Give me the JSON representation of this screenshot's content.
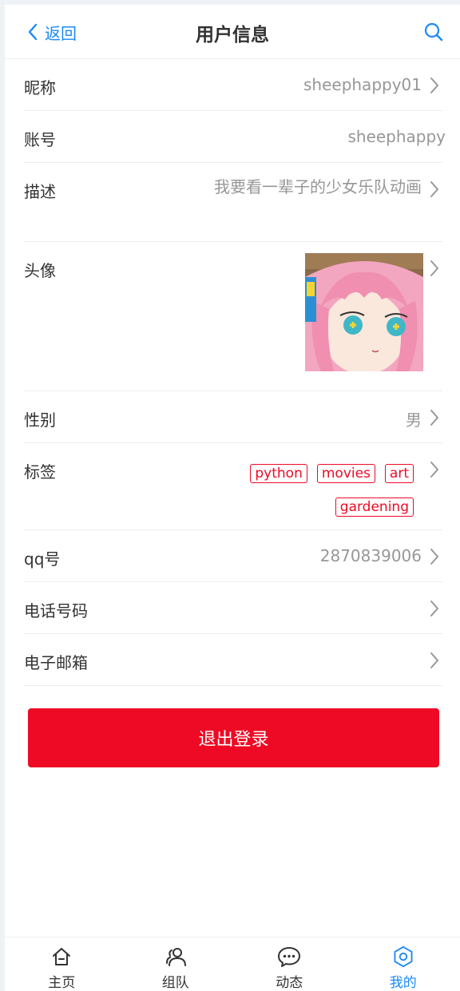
{
  "nav": {
    "back_label": "返回",
    "title": "用户信息"
  },
  "fields": {
    "nickname": {
      "label": "昵称",
      "value": "sheephappy01"
    },
    "account": {
      "label": "账号",
      "value": "sheephappy"
    },
    "description": {
      "label": "描述",
      "value": "我要看一辈子的少女乐队动画"
    },
    "avatar": {
      "label": "头像"
    },
    "gender": {
      "label": "性别",
      "value": "男"
    },
    "tags": {
      "label": "标签",
      "items": [
        "python",
        "movies",
        "art",
        "gardening"
      ]
    },
    "qq": {
      "label": "qq号",
      "value": "2870839006"
    },
    "phone": {
      "label": "电话号码",
      "value": ""
    },
    "email": {
      "label": "电子邮箱",
      "value": ""
    }
  },
  "logout_label": "退出登录",
  "tabbar": {
    "items": [
      {
        "label": "主页",
        "icon": "home-icon"
      },
      {
        "label": "组队",
        "icon": "team-icon"
      },
      {
        "label": "动态",
        "icon": "chat-icon"
      },
      {
        "label": "我的",
        "icon": "settings-icon"
      }
    ],
    "active_index": 3
  },
  "colors": {
    "accent": "#1989fa",
    "danger": "#ee0a24",
    "muted": "#969799",
    "text": "#323233"
  }
}
